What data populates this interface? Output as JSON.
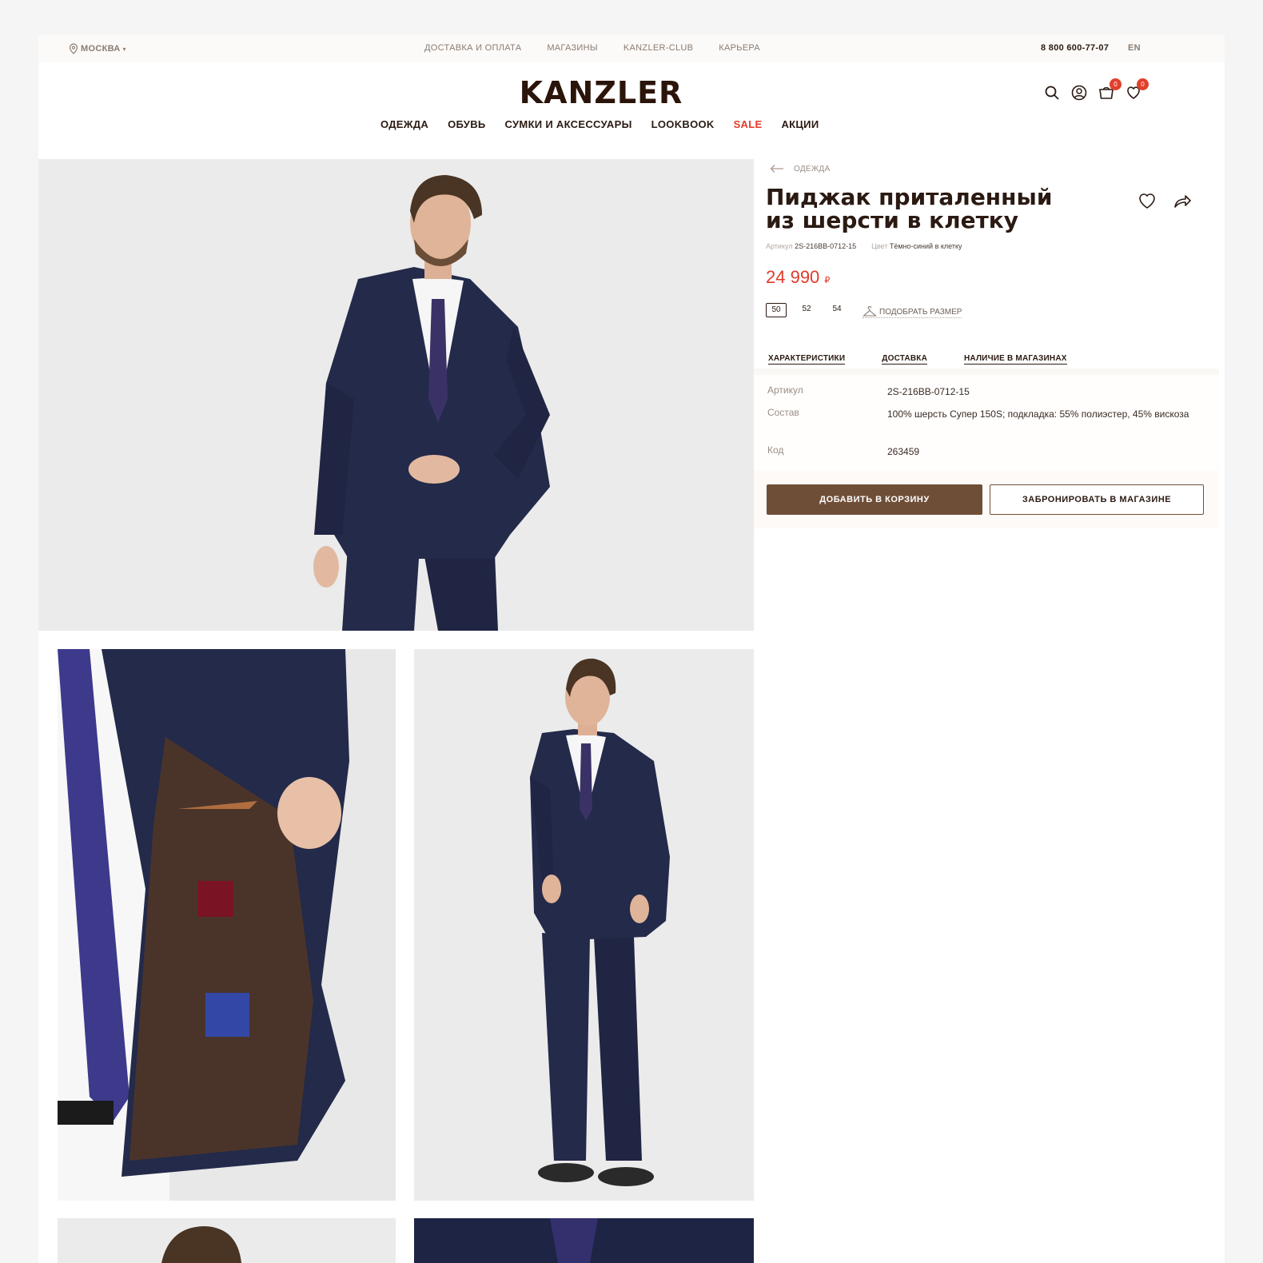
{
  "topbar": {
    "city": "МОСКВА",
    "links": [
      "ДОСТАВКА И ОПЛАТА",
      "МАГАЗИНЫ",
      "KANZLER-CLUB",
      "КАРЬЕРА"
    ],
    "phone": "8 800 600-77-07",
    "lang": "EN"
  },
  "header": {
    "logo": "KANZLER",
    "cart_count": "0",
    "wishlist_count": "0",
    "nav": [
      "ОДЕЖДА",
      "ОБУВЬ",
      "СУМКИ И АКСЕССУАРЫ",
      "LOOKBOOK",
      "SALE",
      "АКЦИИ"
    ]
  },
  "product": {
    "breadcrumb": "ОДЕЖДА",
    "title_line1": "Пиджак приталенный",
    "title_line2": "из шерсти в клетку",
    "article_label": "Артикул",
    "article_value": "2S-216BB-0712-15",
    "color_label": "Цвет",
    "color_value": "Тёмно-синий в клетку",
    "price": "24 990",
    "currency": "₽",
    "sizes": [
      "50",
      "52",
      "54"
    ],
    "selected_size": "50",
    "size_guide": "ПОДОБРАТЬ РАЗМЕР",
    "tabs": [
      "ХАРАКТЕРИСТИКИ",
      "ДОСТАВКА",
      "НАЛИЧИЕ В МАГАЗИНАХ"
    ],
    "specs": [
      {
        "key": "Артикул",
        "value": "2S-216BB-0712-15"
      },
      {
        "key": "Состав",
        "value": "100% шерсть Супер 150S; подкладка: 55% полиэстер, 45% вискоза"
      },
      {
        "key": "Код",
        "value": "263459"
      }
    ],
    "add_to_cart": "ДОБАВИТЬ В КОРЗИНУ",
    "reserve": "ЗАБРОНИРОВАТЬ В МАГАЗИНЕ"
  },
  "colors": {
    "accent_brown": "#6f4e37",
    "sale_red": "#e03a2a",
    "text_dark": "#2b1a12",
    "suit_navy": "#232a4a"
  }
}
